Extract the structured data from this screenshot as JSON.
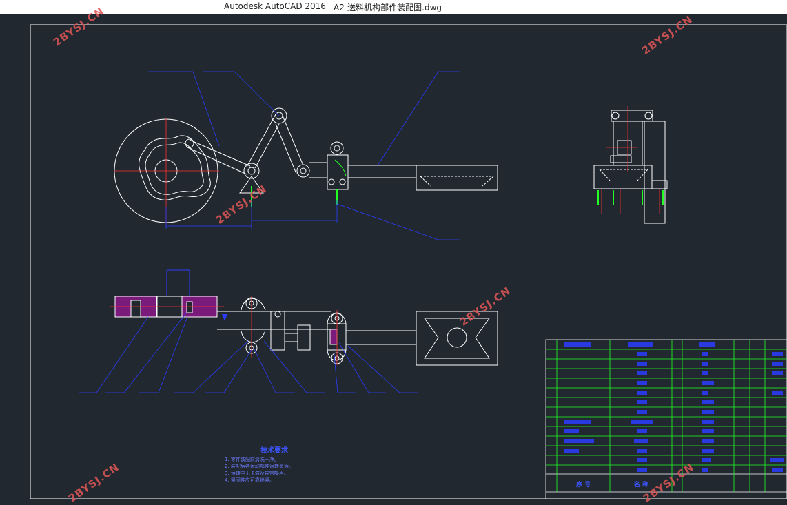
{
  "window": {
    "app_title": "Autodesk AutoCAD 2016",
    "file_name": "A2-送料机构部件装配图.dwg"
  },
  "watermark": {
    "text": "2BYSJ.CN",
    "color": "#e05656"
  },
  "colors": {
    "background": "#212830",
    "drawing_lines": "#ffffff",
    "leader_lines": "#2b3cff",
    "center_lines": "#ff3030",
    "hatch": "#c020c0",
    "table_grid": "#22ff22",
    "yellow_dims": "#f0e030"
  },
  "tech_notes": {
    "title": "技术要求",
    "lines": [
      "1. 零件装配前清洗干净。",
      "2. 装配后各运动部件运转灵活。",
      "3. 运转中无卡滞及异常噪声。",
      "4. 紧固件应可靠锁紧。"
    ]
  },
  "title_block": {
    "header_label_1": "序 号",
    "header_label_2": "名 称"
  }
}
